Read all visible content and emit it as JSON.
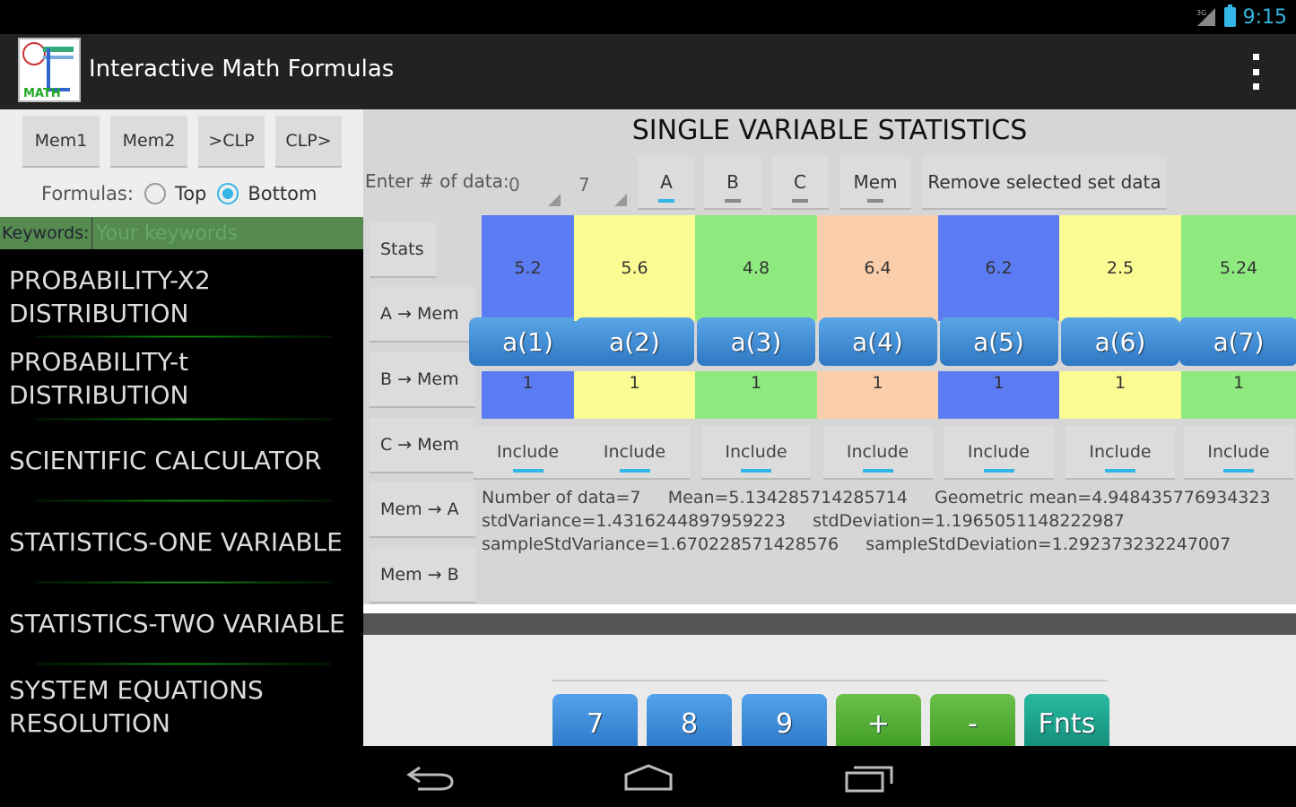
{
  "status": {
    "time": "9:15",
    "network": "3G"
  },
  "app": {
    "title": "Interactive Math Formulas",
    "icon_text": "MATH"
  },
  "left": {
    "mem_buttons": [
      "Mem1",
      "Mem2",
      ">CLP",
      "CLP>"
    ],
    "formulas_label": "Formulas:",
    "options": [
      "Top",
      "Bottom"
    ],
    "selected_option": "Bottom",
    "keywords_label": "Keywords:",
    "keywords_placeholder": "Your keywords",
    "menu": [
      {
        "line1": "PROBABILITY-X2",
        "line2": "DISTRIBUTION"
      },
      {
        "line1": "PROBABILITY-t",
        "line2": "DISTRIBUTION"
      },
      {
        "line1": "SCIENTIFIC CALCULATOR",
        "line2": ""
      },
      {
        "line1": "STATISTICS-ONE VARIABLE",
        "line2": ""
      },
      {
        "line1": "STATISTICS-TWO VARIABLE",
        "line2": ""
      },
      {
        "line1": "SYSTEM EQUATIONS",
        "line2": "RESOLUTION"
      }
    ]
  },
  "main": {
    "title": "SINGLE VARIABLE STATISTICS",
    "enter_label": "Enter # of data:",
    "field1": "0",
    "field2": "7",
    "set_buttons": [
      "A",
      "B",
      "C",
      "Mem"
    ],
    "remove_button": "Remove selected set data",
    "side_buttons": [
      "Stats",
      "A → Mem",
      "B → Mem",
      "C → Mem",
      "Mem → A",
      "Mem → B"
    ],
    "data": [
      {
        "value": "5.2",
        "label": "a(1)",
        "index": "1",
        "color": "#5b7cf2"
      },
      {
        "value": "5.6",
        "label": "a(2)",
        "index": "1",
        "color": "#fafb93"
      },
      {
        "value": "4.8",
        "label": "a(3)",
        "index": "1",
        "color": "#8ee97f"
      },
      {
        "value": "6.4",
        "label": "a(4)",
        "index": "1",
        "color": "#fbceab"
      },
      {
        "value": "6.2",
        "label": "a(5)",
        "index": "1",
        "color": "#5b7cf2"
      },
      {
        "value": "2.5",
        "label": "a(6)",
        "index": "1",
        "color": "#fafb93"
      },
      {
        "value": "5.24",
        "label": "a(7)",
        "index": "1",
        "color": "#8ee97f"
      }
    ],
    "include_label": "Include",
    "results": [
      "Number of data=7     Mean=5.134285714285714     Geometric mean=4.948435776934323",
      "stdVariance=1.4316244897959223     stdDeviation=1.196505114822298​7",
      "sampleStdVariance=1.670228571428576     sampleStdDeviation=1.292373232247007"
    ],
    "keys": [
      {
        "label": "7",
        "kind": "blue"
      },
      {
        "label": "8",
        "kind": "blue"
      },
      {
        "label": "9",
        "kind": "blue"
      },
      {
        "label": "+",
        "kind": "green"
      },
      {
        "label": "-",
        "kind": "green"
      },
      {
        "label": "Fnts",
        "kind": "teal"
      }
    ]
  },
  "nav": {
    "back": "back-icon",
    "home": "home-icon",
    "recents": "recents-icon"
  }
}
